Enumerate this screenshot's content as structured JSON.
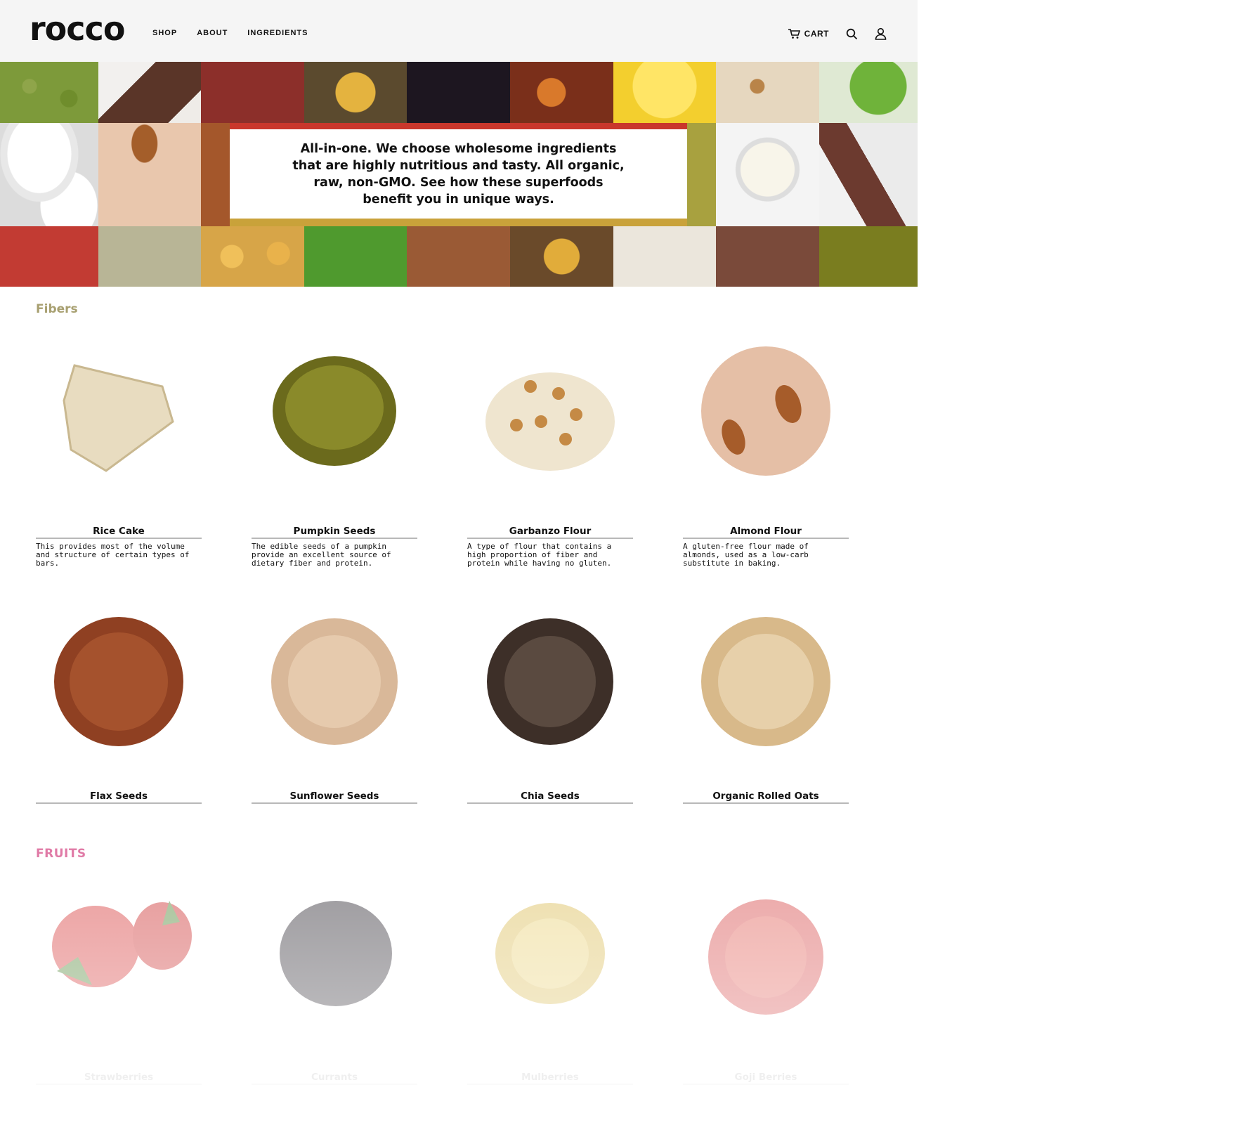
{
  "header": {
    "logo": "rocco",
    "nav": [
      "SHOP",
      "ABOUT",
      "INGREDIENTS"
    ],
    "cart_label": "CART",
    "icons": [
      "cart-icon",
      "search-icon",
      "account-icon"
    ]
  },
  "hero": {
    "text": "All-in-one. We choose wholesome ingredients that are highly nutritious and tasty. All organic, raw, non-GMO. See how these superfoods benefit you in unique ways."
  },
  "fibers": {
    "title": "Fibers",
    "items": [
      {
        "name": "Rice Cake",
        "desc": "This provides most of the volume and structure of certain types of bars."
      },
      {
        "name": "Pumpkin Seeds",
        "desc": "The edible seeds of a pumpkin provide an excellent source of dietary fiber and protein."
      },
      {
        "name": "Garbanzo Flour",
        "desc": "A type of flour that contains a high proportion of fiber and protein while having no gluten."
      },
      {
        "name": "Almond Flour",
        "desc": "A gluten-free flour made of almonds, used as a low-carb substitute in baking."
      },
      {
        "name": "Flax Seeds",
        "desc": ""
      },
      {
        "name": "Sunflower Seeds",
        "desc": ""
      },
      {
        "name": "Chia Seeds",
        "desc": ""
      },
      {
        "name": "Organic Rolled Oats",
        "desc": ""
      }
    ]
  },
  "fruits": {
    "title": "FRUITS",
    "items": [
      {
        "name": "Strawberries"
      },
      {
        "name": "Currants"
      },
      {
        "name": "Mulberries"
      },
      {
        "name": "Goji Berries"
      }
    ]
  },
  "colors": {
    "fibers_heading": "#a8a071",
    "fruits_heading": "#e07aa6",
    "header_bg": "#f5f5f5"
  }
}
